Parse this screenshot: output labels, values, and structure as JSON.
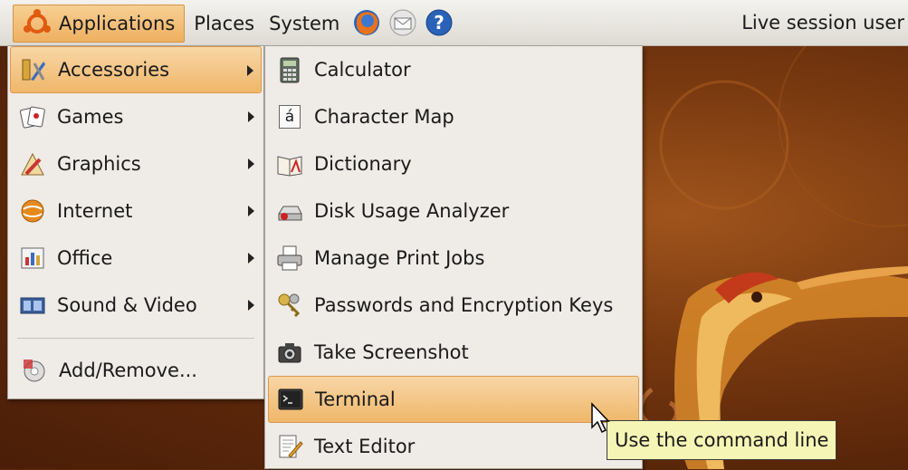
{
  "panel": {
    "applications_label": "Applications",
    "places_label": "Places",
    "system_label": "System",
    "launchers": [
      "firefox-icon",
      "mail-icon",
      "help-icon"
    ],
    "user_label": "Live session user"
  },
  "main_menu": {
    "items": [
      {
        "label": "Accessories",
        "icon": "accessories-icon",
        "submenu": true,
        "highlighted": true
      },
      {
        "label": "Games",
        "icon": "games-icon",
        "submenu": true
      },
      {
        "label": "Graphics",
        "icon": "graphics-icon",
        "submenu": true
      },
      {
        "label": "Internet",
        "icon": "internet-icon",
        "submenu": true
      },
      {
        "label": "Office",
        "icon": "office-icon",
        "submenu": true
      },
      {
        "label": "Sound & Video",
        "icon": "sound-video-icon",
        "submenu": true
      }
    ],
    "footer_item": {
      "label": "Add/Remove...",
      "icon": "add-remove-icon"
    }
  },
  "accessories_menu": {
    "items": [
      {
        "label": "Calculator",
        "icon": "calculator-icon"
      },
      {
        "label": "Character Map",
        "icon": "character-map-icon",
        "glyph": "á"
      },
      {
        "label": "Dictionary",
        "icon": "dictionary-icon"
      },
      {
        "label": "Disk Usage Analyzer",
        "icon": "disk-usage-icon"
      },
      {
        "label": "Manage Print Jobs",
        "icon": "printer-icon"
      },
      {
        "label": "Passwords and Encryption Keys",
        "icon": "keys-icon"
      },
      {
        "label": "Take Screenshot",
        "icon": "camera-icon"
      },
      {
        "label": "Terminal",
        "icon": "terminal-icon",
        "highlighted": true
      },
      {
        "label": "Text Editor",
        "icon": "text-editor-icon"
      }
    ]
  },
  "tooltip": {
    "text": "Use the command line"
  },
  "colors": {
    "highlight": "#efb76a",
    "menu_bg": "#efebe7",
    "panel_bg": "#dedbd4",
    "wallpaper": "#7a3a10",
    "tooltip_bg": "#f5f5b5"
  }
}
